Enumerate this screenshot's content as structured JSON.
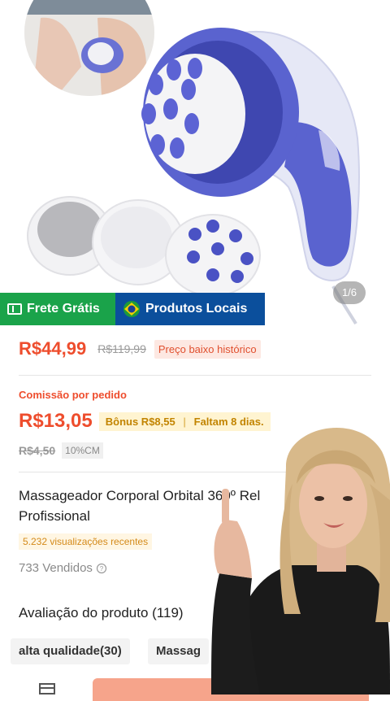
{
  "gallery": {
    "counter": "1/6"
  },
  "badges": {
    "free_shipping": "Frete Grátis",
    "local_products": "Produtos Locais"
  },
  "price": {
    "current": "R$44,99",
    "original": "R$119,99",
    "tag": "Preço baixo histórico"
  },
  "commission": {
    "label": "Comissão por pedido",
    "value": "R$13,05",
    "bonus": "Bônus R$8,55",
    "days_left": "Faltam 8 dias.",
    "old_value": "R$4,50",
    "rate": "10%CM"
  },
  "product": {
    "title": "Massageador Corporal Orbital 360º Rel",
    "title_line2": "Profissional",
    "views": "5.232 visualizações recentes",
    "sold": "733 Vendidos"
  },
  "reviews": {
    "title": "Avaliação do produto (119)",
    "chips": [
      "alta qualidade(30)",
      "Massag"
    ]
  },
  "colors": {
    "accent": "#ee4d2d",
    "free_badge": "#1aa34a",
    "local_badge": "#0b4f9c",
    "massager": "#5a63cf"
  },
  "icons": [
    "ticket-icon",
    "brazil-flag-icon",
    "info-circle-icon",
    "store-icon"
  ]
}
